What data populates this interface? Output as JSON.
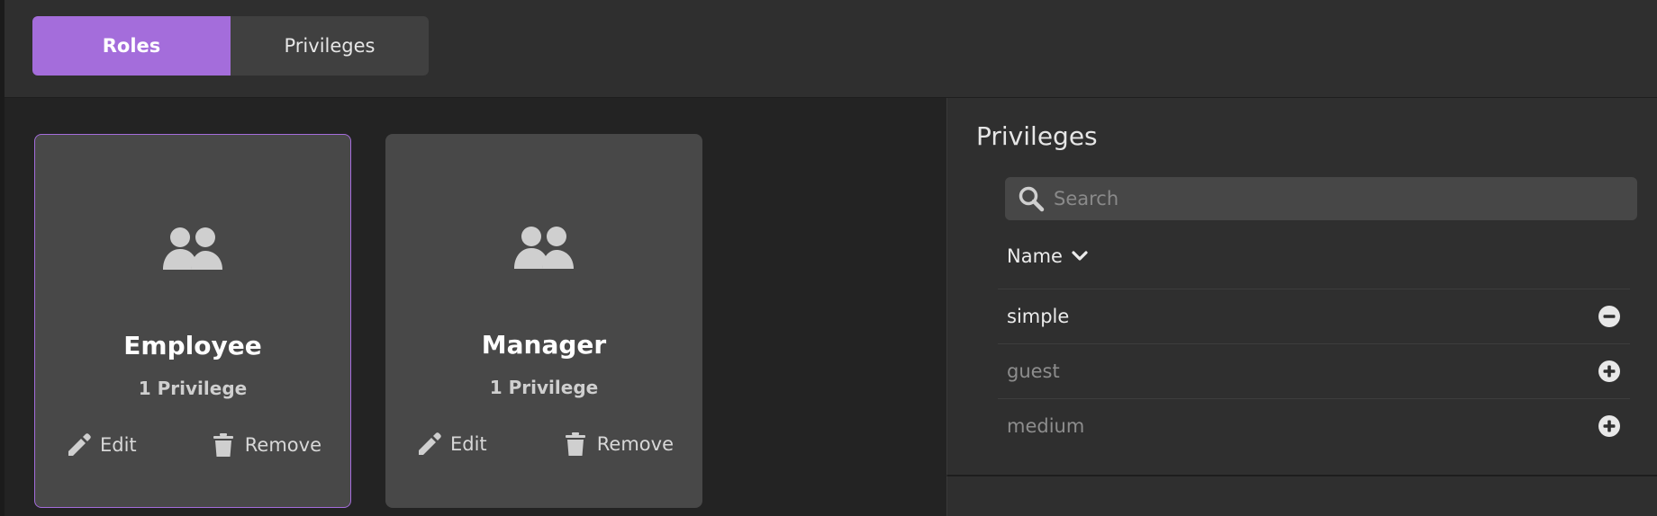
{
  "tabs": [
    {
      "label": "Roles",
      "active": true
    },
    {
      "label": "Privileges",
      "active": false
    }
  ],
  "cards": [
    {
      "name": "Employee",
      "count": "1 Privilege",
      "edit": "Edit",
      "remove": "Remove",
      "selected": true
    },
    {
      "name": "Manager",
      "count": "1 Privilege",
      "edit": "Edit",
      "remove": "Remove",
      "selected": false
    }
  ],
  "panel": {
    "title": "Privileges",
    "search_placeholder": "Search",
    "column": "Name",
    "rows": [
      {
        "name": "simple",
        "assigned": true
      },
      {
        "name": "guest",
        "assigned": false
      },
      {
        "name": "medium",
        "assigned": false
      }
    ]
  },
  "colors": {
    "accent": "#a46ddb",
    "background": "#232323",
    "surface": "#2f2f2f",
    "card": "#484848"
  },
  "icons": {
    "card": "people-icon",
    "edit": "pencil-icon",
    "remove": "trash-icon",
    "search": "search-icon",
    "sort": "chevron-down-icon",
    "assigned": "minus-circle-icon",
    "unassigned": "plus-circle-icon"
  }
}
